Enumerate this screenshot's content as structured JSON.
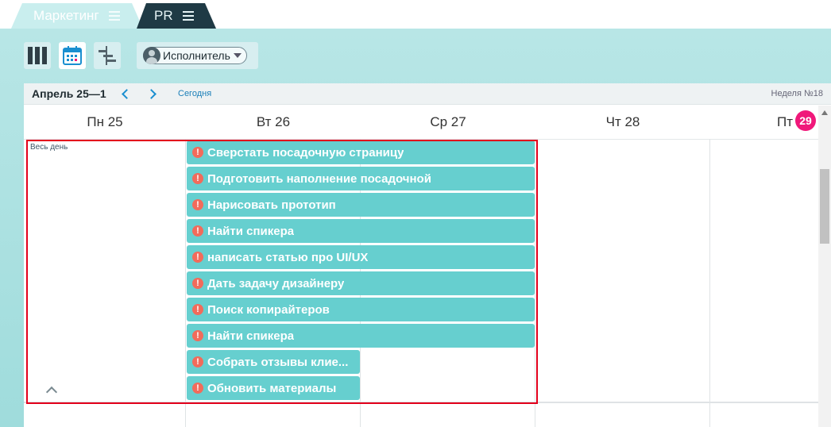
{
  "tabs": [
    {
      "label": "Маркетинг",
      "active": true
    },
    {
      "label": "PR",
      "active": false
    }
  ],
  "toolbar": {
    "view_buttons": [
      "columns-icon",
      "calendar-icon",
      "gantt-icon"
    ],
    "assignee_label": "Исполнитель"
  },
  "calendar": {
    "range": "Апрель 25—1",
    "today_label": "Сегодня",
    "week_label": "Неделя №18",
    "allday_label": "Весь день",
    "days": [
      {
        "label": "Пн 25"
      },
      {
        "label": "Вт 26"
      },
      {
        "label": "Ср 27"
      },
      {
        "label": "Чт 28"
      },
      {
        "label": "Пт",
        "badge": "29"
      }
    ],
    "events": [
      {
        "title": "Сверстать посадочную страницу",
        "span": "Вт–Ср"
      },
      {
        "title": "Подготовить наполнение посадочной",
        "span": "Вт–Ср"
      },
      {
        "title": "Нарисовать прототип",
        "span": "Вт–Ср"
      },
      {
        "title": "Найти спикера",
        "span": "Вт–Ср"
      },
      {
        "title": "написать статью про UI/UX",
        "span": "Вт–Ср"
      },
      {
        "title": "Дать задачу дизайнеру",
        "span": "Вт–Ср"
      },
      {
        "title": "Поиск копирайтеров",
        "span": "Вт–Ср"
      },
      {
        "title": "Найти спикера",
        "span": "Вт–Ср"
      },
      {
        "title": "Собрать отзывы клие...",
        "span": "Вт"
      },
      {
        "title": "Обновить материалы",
        "span": "Вт"
      }
    ],
    "event_icon": "!"
  },
  "colors": {
    "event_bg": "#66cfcf",
    "event_alert": "#f26b5b",
    "today_badge": "#f0187a",
    "highlight": "#e3001b",
    "link": "#1a7fb8"
  }
}
